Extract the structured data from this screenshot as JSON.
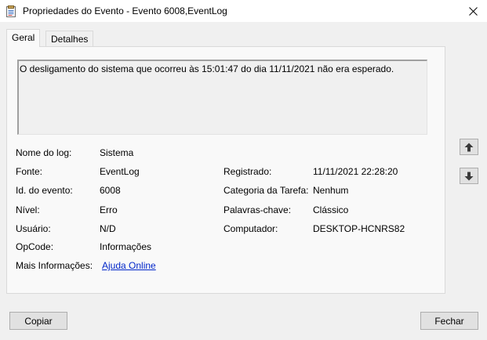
{
  "window": {
    "title": "Propriedades do Evento - Evento 6008,EventLog"
  },
  "tabs": [
    {
      "label": "Geral"
    },
    {
      "label": "Detalhes"
    }
  ],
  "description": "O desligamento do sistema que ocorreu às 15:01:47 do dia 11/11/2021 não era esperado.",
  "fields": {
    "log_name": {
      "label": "Nome do log:",
      "value": "Sistema"
    },
    "source": {
      "label": "Fonte:",
      "value": "EventLog"
    },
    "event_id": {
      "label": "Id. do evento:",
      "value": "6008"
    },
    "level": {
      "label": "Nível:",
      "value": "Erro"
    },
    "user": {
      "label": "Usuário:",
      "value": "N/D"
    },
    "opcode": {
      "label": "OpCode:",
      "value": "Informações"
    },
    "more_info": {
      "label": "Mais Informações:",
      "value": "Ajuda Online"
    },
    "logged": {
      "label": "Registrado:",
      "value": "11/11/2021 22:28:20"
    },
    "task_category": {
      "label": "Categoria da Tarefa:",
      "value": "Nenhum"
    },
    "keywords": {
      "label": "Palavras-chave:",
      "value": "Clássico"
    },
    "computer": {
      "label": "Computador:",
      "value": "DESKTOP-HCNRS82"
    }
  },
  "buttons": {
    "copy": "Copiar",
    "close": "Fechar"
  },
  "icons": {
    "up": "arrow-up-icon",
    "down": "arrow-down-icon",
    "close": "close-icon",
    "app": "event-properties-icon"
  }
}
